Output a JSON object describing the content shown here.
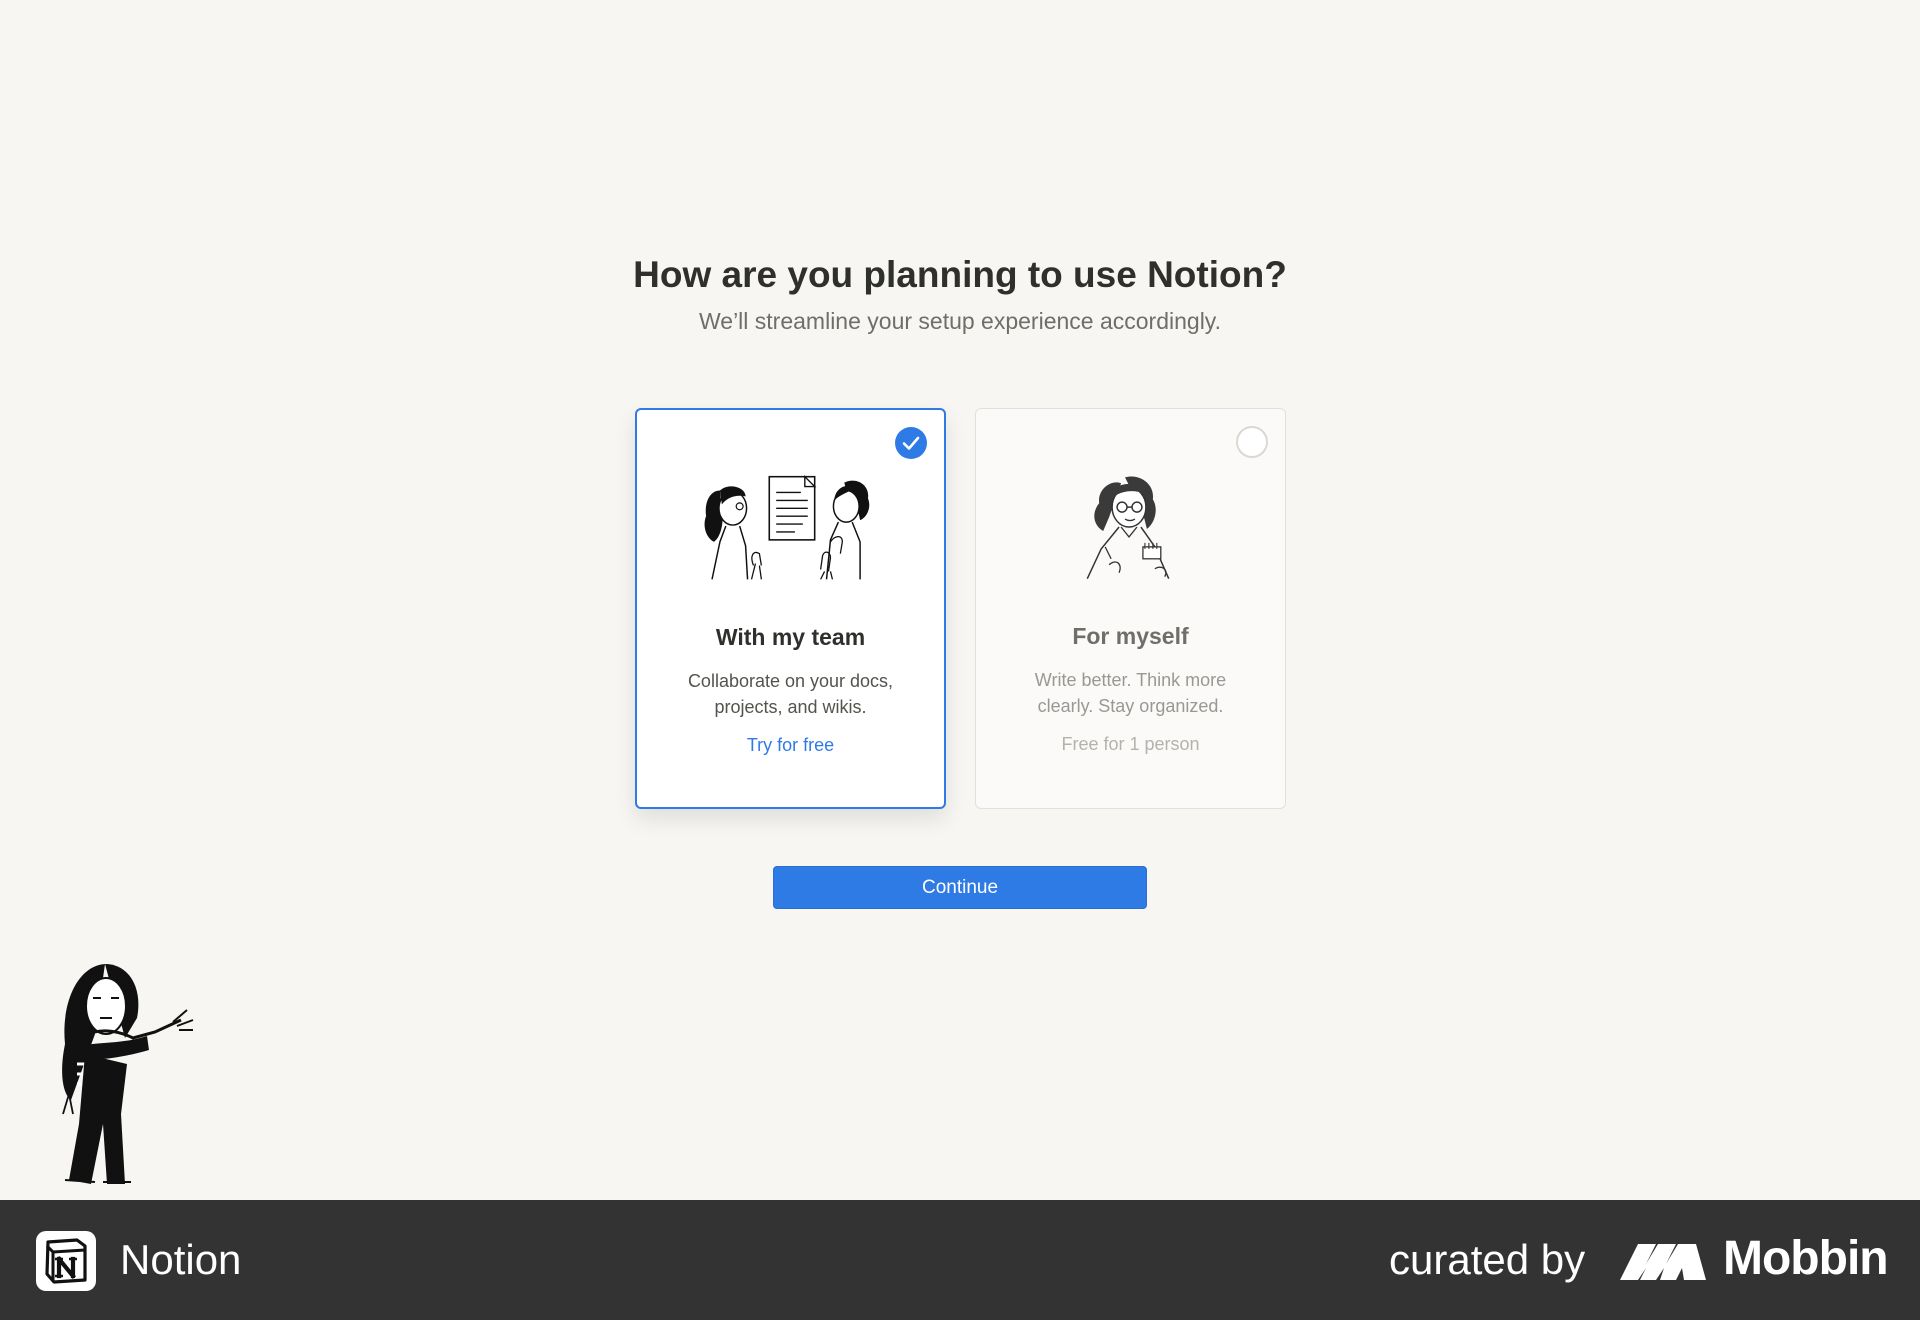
{
  "page": {
    "heading": "How are you planning to use Notion?",
    "subheading": "We’ll streamline your setup experience accordingly."
  },
  "options": [
    {
      "title": "With my team",
      "description": "Collaborate on your docs, projects, and wikis.",
      "cta": "Try for free",
      "selected": true
    },
    {
      "title": "For myself",
      "description": "Write better. Think more clearly. Stay organized.",
      "cta": "Free for 1 person",
      "selected": false
    }
  ],
  "continue_label": "Continue",
  "footer": {
    "app_name": "Notion",
    "curated_label": "curated by",
    "curator_name": "Mobbin"
  },
  "icons": {
    "selected": "check-icon",
    "unselected": "radio-empty-icon",
    "team_illustration": "team-illustration",
    "self_illustration": "self-illustration",
    "mascot": "mascot-illustration",
    "app_logo": "notion-logo-icon",
    "curator_logo": "mobbin-logo-icon"
  },
  "colors": {
    "accent": "#2f7be6",
    "background": "#f7f6f3",
    "footer": "#333333"
  }
}
